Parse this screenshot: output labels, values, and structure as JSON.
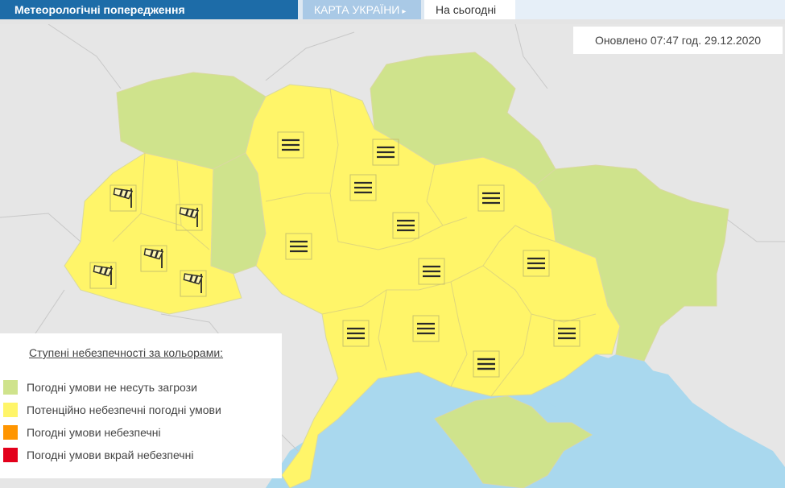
{
  "header": {
    "title": "Метеорологічні попередження",
    "map_tab": "КАРТА УКРАЇНИ",
    "map_tab_arrow": "▸",
    "today_tab": "На сьогодні"
  },
  "updated_text": "Оновлено 07:47 год. 29.12.2020",
  "colors": {
    "no_threat": "#cfe38c",
    "potential": "#fff569",
    "dangerous": "#ff9500",
    "very_dangerous": "#e3001b",
    "sea": "#a9d8ee",
    "background": "#e4e4e4"
  },
  "legend": {
    "title": "Ступені небезпечності за кольорами:",
    "items": [
      {
        "label": "Погодні умови не несуть загрози",
        "color": "#cfe38c"
      },
      {
        "label": "Потенційно небезпечні погодні умови",
        "color": "#fff569"
      },
      {
        "label": "Погодні умови небезпечні",
        "color": "#ff9500"
      },
      {
        "label": "Погодні умови вкрай небезпечні",
        "color": "#e3001b"
      }
    ]
  },
  "warning_icons": [
    {
      "type": "fog-icon"
    },
    {
      "type": "fog-icon"
    },
    {
      "type": "fog-icon"
    },
    {
      "type": "fog-icon"
    },
    {
      "type": "fog-icon"
    },
    {
      "type": "fog-icon"
    },
    {
      "type": "fog-icon"
    },
    {
      "type": "fog-icon"
    },
    {
      "type": "fog-icon"
    },
    {
      "type": "fog-icon"
    },
    {
      "type": "fog-icon"
    },
    {
      "type": "fog-icon"
    },
    {
      "type": "fog-icon"
    },
    {
      "type": "wind-icon"
    },
    {
      "type": "wind-icon"
    },
    {
      "type": "wind-icon"
    },
    {
      "type": "wind-icon"
    },
    {
      "type": "wind-icon"
    }
  ]
}
